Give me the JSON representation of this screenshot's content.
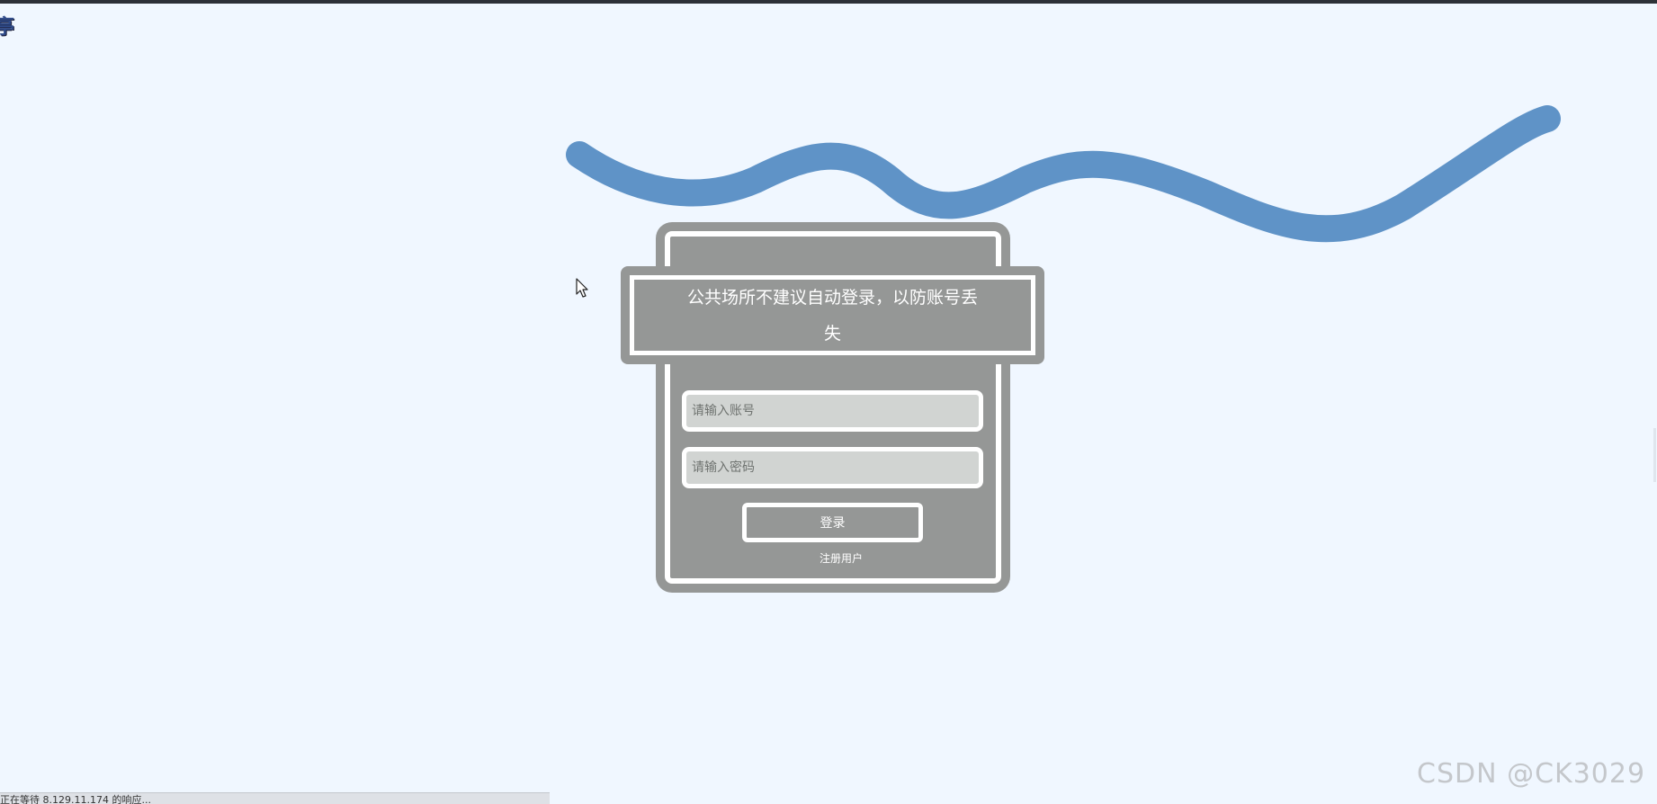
{
  "page": {
    "corner_glyph": "亭",
    "notice_text": "公共场所不建议自动登录，以防账号丢失",
    "watermark": "CSDN @CK3029",
    "status_text": "正在等待 8.129.11.174 的响应..."
  },
  "login_form": {
    "account_placeholder": "请输入账号",
    "password_placeholder": "请输入密码",
    "login_label": "登录",
    "register_label": "注册用户"
  },
  "colors": {
    "background": "#f0f7ff",
    "card": "#959796",
    "input_fill": "#d1d4d2",
    "wave": "#5f93c7",
    "border": "#ffffff"
  },
  "icons": [
    "mouse-cursor-icon"
  ]
}
